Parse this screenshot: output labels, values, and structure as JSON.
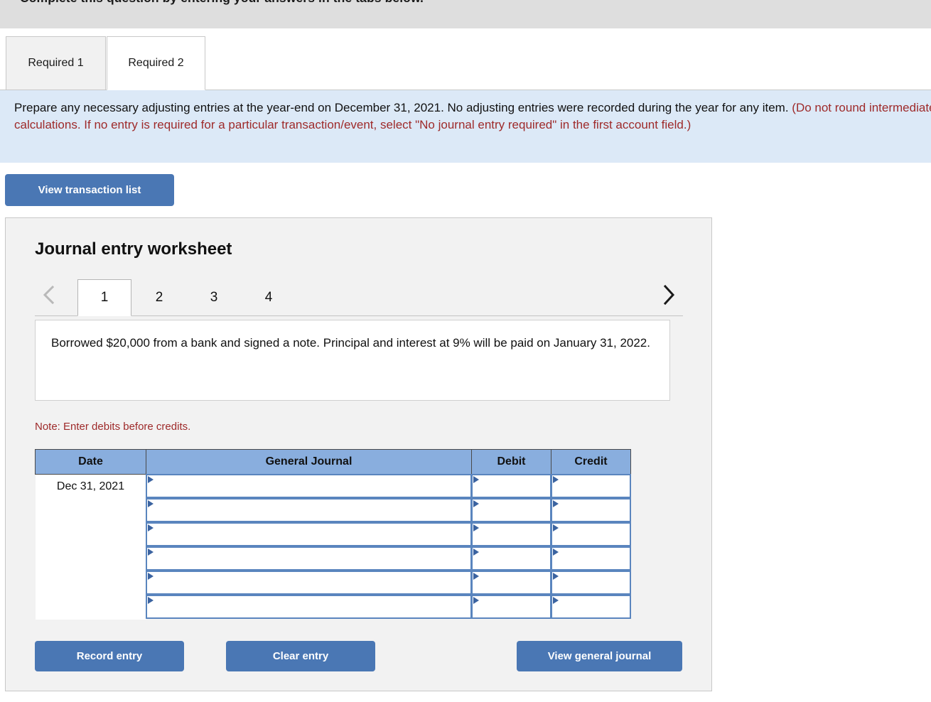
{
  "banner": {
    "text": "Complete this question by entering your answers in the tabs below."
  },
  "required_tabs": [
    {
      "label": "Required 1",
      "active": false
    },
    {
      "label": "Required 2",
      "active": true
    }
  ],
  "instructions": {
    "black_part_1": "Prepare any necessary adjusting entries at the year-end on December 31, 2021. No adjusting entries were recorded during the year for any item. ",
    "red_part": "(Do not round intermediate calculations. If no entry is required for a particular transaction/event, select \"No journal entry required\" in the first account field.)"
  },
  "buttons": {
    "view_transaction_list": "View transaction list",
    "record_entry": "Record entry",
    "clear_entry": "Clear entry",
    "view_general_journal": "View general journal"
  },
  "worksheet": {
    "title": "Journal entry worksheet",
    "pager": {
      "prev_icon": "chevron-left-icon",
      "next_icon": "chevron-right-icon",
      "prev_enabled": false,
      "next_enabled": true
    },
    "tabs": [
      {
        "label": "1",
        "active": true
      },
      {
        "label": "2",
        "active": false
      },
      {
        "label": "3",
        "active": false
      },
      {
        "label": "4",
        "active": false
      }
    ],
    "transaction_text": "Borrowed $20,000 from a bank and signed a note. Principal and interest at 9% will be paid on January 31, 2022.",
    "note": "Note: Enter debits before credits."
  },
  "journal_table": {
    "headers": [
      "Date",
      "General Journal",
      "Debit",
      "Credit"
    ],
    "rows": [
      {
        "date": "Dec 31, 2021",
        "general_journal": "",
        "debit": "",
        "credit": ""
      },
      {
        "date": "",
        "general_journal": "",
        "debit": "",
        "credit": ""
      },
      {
        "date": "",
        "general_journal": "",
        "debit": "",
        "credit": ""
      },
      {
        "date": "",
        "general_journal": "",
        "debit": "",
        "credit": ""
      },
      {
        "date": "",
        "general_journal": "",
        "debit": "",
        "credit": ""
      },
      {
        "date": "",
        "general_journal": "",
        "debit": "",
        "credit": ""
      }
    ]
  },
  "colors": {
    "button_blue": "#4a77b4",
    "table_header_blue": "#89aede",
    "instruction_band": "#dce9f7",
    "red_text": "#9e2a2a",
    "input_border": "#5a85be"
  }
}
